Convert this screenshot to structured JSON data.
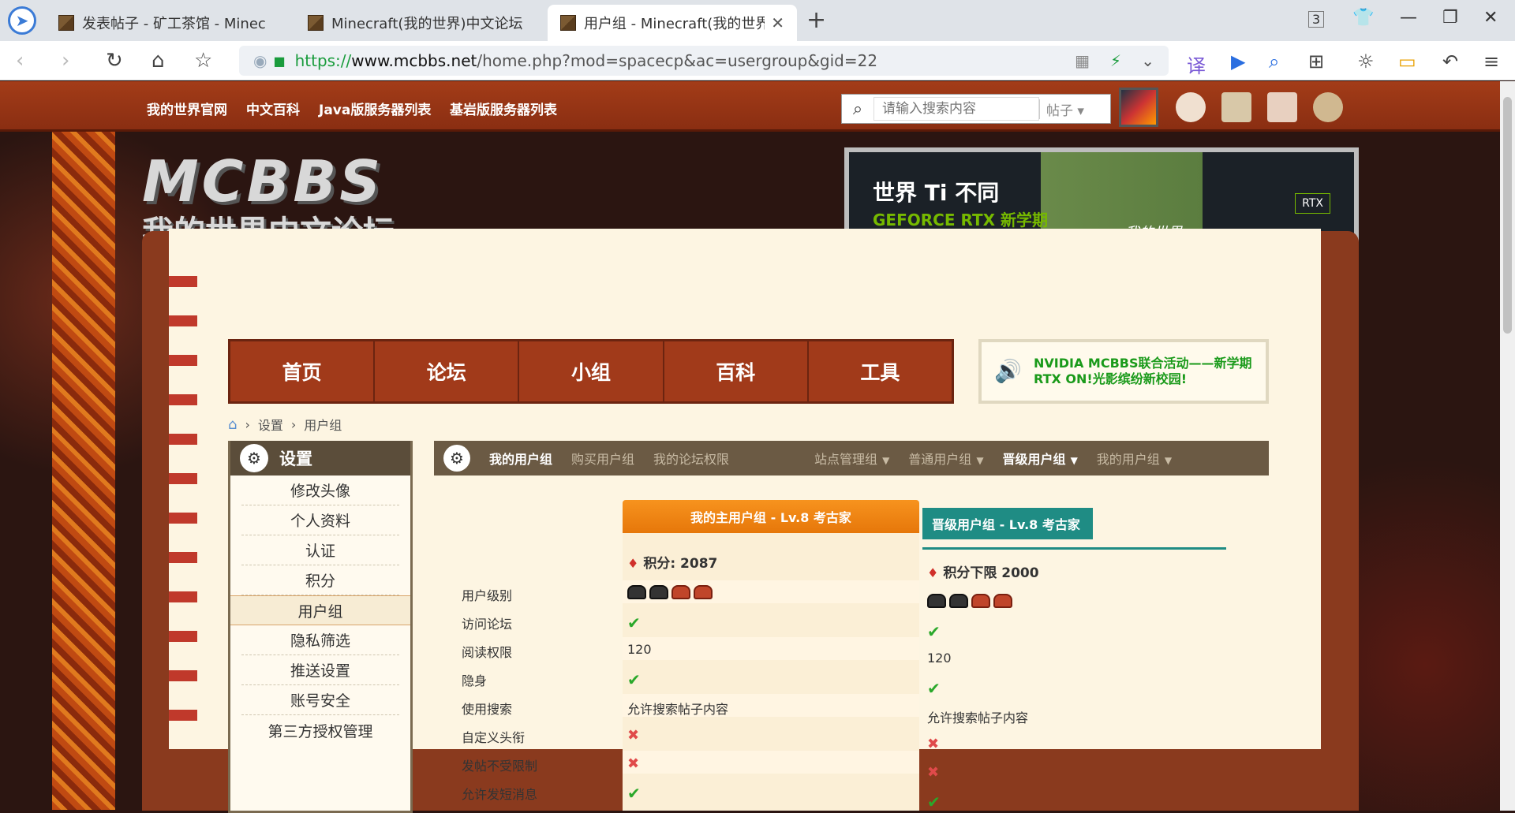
{
  "browser": {
    "tabs": [
      {
        "title": "发表帖子 - 矿工茶馆 - Minec"
      },
      {
        "title": "Minecraft(我的世界)中文论坛"
      },
      {
        "title": "用户组 - Minecraft(我的世界"
      }
    ],
    "tab_count": "3",
    "url": {
      "proto": "https://",
      "host": "www.mcbbs.net",
      "path": "/home.php?mod=spacecp&ac=usergroup&gid=22"
    }
  },
  "topnav": {
    "links": [
      "我的世界官网",
      "中文百科",
      "Java版服务器列表",
      "基岩版服务器列表"
    ],
    "search_placeholder": "请输入搜索内容",
    "search_type": "帖子"
  },
  "logo": {
    "line1": "MCBBS",
    "line2": "我的世界中文论坛"
  },
  "banner": {
    "title": "世界 Ti 不同",
    "subtitle": "GEFORCE RTX 新学期",
    "caption": "我的世界",
    "badge": "RTX"
  },
  "mainnav": [
    "首页",
    "论坛",
    "小组",
    "百科",
    "工具"
  ],
  "notice": "NVIDIA MCBBS联合活动——新学期RTX ON!光影缤纷新校园!",
  "breadcrumb": [
    "设置",
    "用户组"
  ],
  "sidebar": {
    "title": "设置",
    "items": [
      "修改头像",
      "个人资料",
      "认证",
      "积分",
      "用户组",
      "隐私筛选",
      "推送设置",
      "账号安全",
      "第三方授权管理"
    ]
  },
  "maintabs": {
    "left": [
      "我的用户组",
      "购买用户组",
      "我的论坛权限"
    ],
    "right": [
      "站点管理组",
      "普通用户组",
      "晋级用户组",
      "我的用户组"
    ]
  },
  "table": {
    "main_header": "我的主用户组 - Lv.8 考古家",
    "upgrade_header": "晋级用户组 - Lv.8 考古家",
    "main_points": "积分: 2087",
    "upgrade_points": "积分下限 2000",
    "rows": [
      {
        "label": "用户级别",
        "main": "stars",
        "up": "stars"
      },
      {
        "label": "访问论坛",
        "main": "check",
        "up": "check"
      },
      {
        "label": "阅读权限",
        "main": "120",
        "up": "120"
      },
      {
        "label": "隐身",
        "main": "check",
        "up": "check"
      },
      {
        "label": "使用搜索",
        "main": "允许搜索帖子内容",
        "up": "允许搜索帖子内容"
      },
      {
        "label": "自定义头衔",
        "main": "cross",
        "up": "cross"
      },
      {
        "label": "发帖不受限制",
        "main": "cross",
        "up": "cross"
      },
      {
        "label": "允许发短消息",
        "main": "check",
        "up": "check"
      }
    ]
  }
}
